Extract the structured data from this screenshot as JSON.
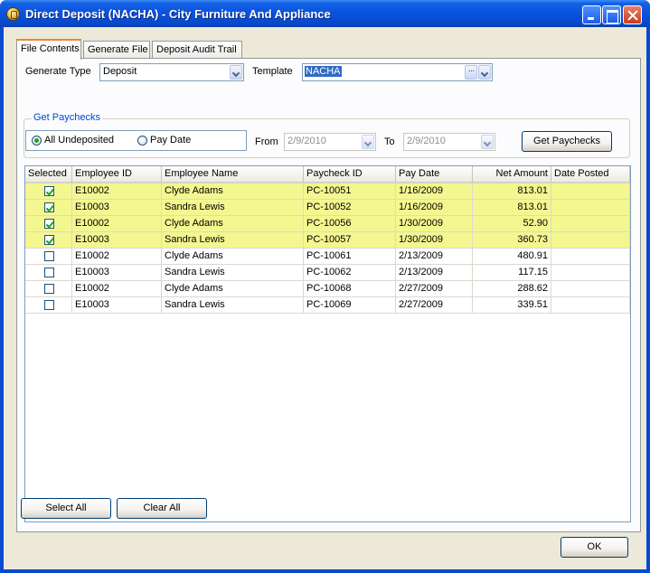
{
  "window": {
    "title": "Direct Deposit (NACHA) - City Furniture And Appliance"
  },
  "tabs": [
    "File Contents",
    "Generate File",
    "Deposit Audit Trail"
  ],
  "form": {
    "generate_type_label": "Generate Type",
    "generate_type_value": "Deposit",
    "template_label": "Template",
    "template_value": "NACHA",
    "ellipsis": "···"
  },
  "get_paychecks": {
    "group_title": "Get Paychecks",
    "radio_all_undeposited": "All Undeposited",
    "radio_pay_date": "Pay Date",
    "selected_radio": "All Undeposited",
    "from_label": "From",
    "from_value": "2/9/2010",
    "to_label": "To",
    "to_value": "2/9/2010",
    "button_label": "Get Paychecks"
  },
  "grid": {
    "columns": [
      "Selected",
      "Employee ID",
      "Employee Name",
      "Paycheck ID",
      "Pay Date",
      "Net Amount",
      "Date Posted"
    ],
    "rows": [
      {
        "selected": true,
        "employee_id": "E10002",
        "employee_name": "Clyde Adams",
        "paycheck_id": "PC-10051",
        "pay_date": "1/16/2009",
        "net_amount": "813.01",
        "date_posted": ""
      },
      {
        "selected": true,
        "employee_id": "E10003",
        "employee_name": "Sandra Lewis",
        "paycheck_id": "PC-10052",
        "pay_date": "1/16/2009",
        "net_amount": "813.01",
        "date_posted": ""
      },
      {
        "selected": true,
        "employee_id": "E10002",
        "employee_name": "Clyde Adams",
        "paycheck_id": "PC-10056",
        "pay_date": "1/30/2009",
        "net_amount": "52.90",
        "date_posted": ""
      },
      {
        "selected": true,
        "employee_id": "E10003",
        "employee_name": "Sandra Lewis",
        "paycheck_id": "PC-10057",
        "pay_date": "1/30/2009",
        "net_amount": "360.73",
        "date_posted": ""
      },
      {
        "selected": false,
        "employee_id": "E10002",
        "employee_name": "Clyde Adams",
        "paycheck_id": "PC-10061",
        "pay_date": "2/13/2009",
        "net_amount": "480.91",
        "date_posted": ""
      },
      {
        "selected": false,
        "employee_id": "E10003",
        "employee_name": "Sandra Lewis",
        "paycheck_id": "PC-10062",
        "pay_date": "2/13/2009",
        "net_amount": "117.15",
        "date_posted": ""
      },
      {
        "selected": false,
        "employee_id": "E10002",
        "employee_name": "Clyde Adams",
        "paycheck_id": "PC-10068",
        "pay_date": "2/27/2009",
        "net_amount": "288.62",
        "date_posted": ""
      },
      {
        "selected": false,
        "employee_id": "E10003",
        "employee_name": "Sandra Lewis",
        "paycheck_id": "PC-10069",
        "pay_date": "2/27/2009",
        "net_amount": "339.51",
        "date_posted": ""
      }
    ],
    "colors": {
      "selected_row": "#f4f78f",
      "accent": "#0046d5"
    }
  },
  "buttons": {
    "select_all": "Select All",
    "clear_all": "Clear All",
    "ok": "OK"
  }
}
